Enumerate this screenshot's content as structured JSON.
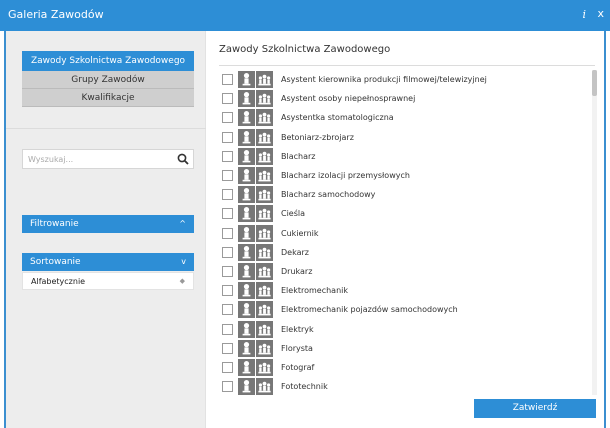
{
  "window": {
    "title": "Galeria Zawodów",
    "info_label": "i",
    "close_label": "x"
  },
  "sidebar": {
    "categories": [
      {
        "label": "Zawody Szkolnictwa Zawodowego",
        "active": true
      },
      {
        "label": "Grupy Zawodów",
        "active": false
      },
      {
        "label": "Kwalifikacje",
        "active": false
      }
    ],
    "search": {
      "placeholder": "Wyszukaj...",
      "value": ""
    },
    "filter": {
      "label": "Filtrowanie",
      "chevron": "^"
    },
    "sort": {
      "label": "Sortowanie",
      "chevron": "v",
      "selected": "Alfabetycznie",
      "updown": "◆"
    }
  },
  "main": {
    "title": "Zawody Szkolnictwa Zawodowego",
    "items": [
      "Asystent kierownika produkcji filmowej/telewizyjnej",
      "Asystent osoby niepełnosprawnej",
      "Asystentka stomatologiczna",
      "Betoniarz-zbrojarz",
      "Blacharz",
      "Blacharz izolacji przemysłowych",
      "Blacharz samochodowy",
      "Cieśla",
      "Cukiernik",
      "Dekarz",
      "Drukarz",
      "Elektromechanik",
      "Elektromechanik pojazdów samochodowych",
      "Elektryk",
      "Florysta",
      "Fotograf",
      "Fototechnik"
    ],
    "confirm_label": "Zatwierdź"
  },
  "colors": {
    "accent": "#2d8ed6",
    "icon_bg": "#777777",
    "sidebar_bg": "#ededed"
  }
}
